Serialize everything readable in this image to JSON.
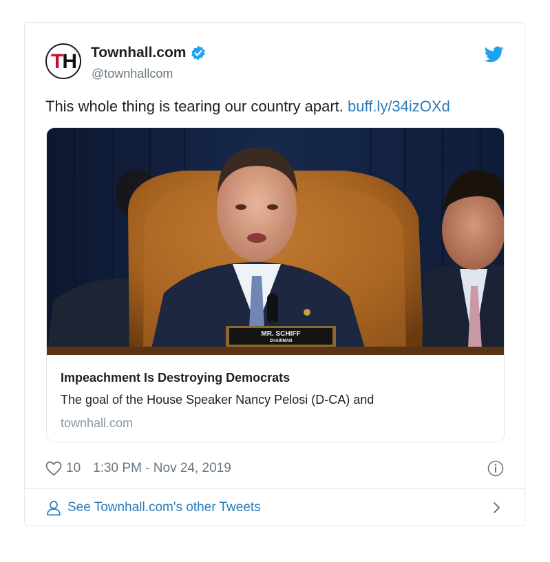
{
  "tweet": {
    "author": {
      "avatar_text_t": "T",
      "avatar_text_h": "H",
      "display_name": "Townhall.com",
      "handle": "@townhallcom",
      "verified_icon": "verified-badge-icon"
    },
    "text": "This whole thing is tearing our country apart. ",
    "link": "buff.ly/34izOXd",
    "card": {
      "nameplate_line1": "MR. SCHIFF",
      "nameplate_line2": "CHAIRMAN",
      "title": "Impeachment Is Destroying Democrats",
      "description": "The goal of the House Speaker Nancy Pelosi (D-CA) and",
      "domain": "townhall.com"
    },
    "likes": "10",
    "timestamp": "1:30 PM - Nov 24, 2019",
    "footer_link": "See Townhall.com's other Tweets"
  },
  "colors": {
    "link": "#2b7bb9",
    "twitter_blue": "#1da1f2",
    "border": "#e1e8ed",
    "muted": "#697882"
  }
}
